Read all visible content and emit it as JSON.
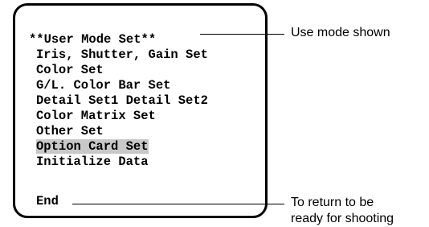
{
  "screen": {
    "title": "**User Mode Set**",
    "items": [
      {
        "label": "Iris, Shutter, Gain Set",
        "highlighted": false
      },
      {
        "label": "Color Set",
        "highlighted": false
      },
      {
        "label": "G/L. Color Bar Set",
        "highlighted": false
      },
      {
        "label": "Detail Set1 Detail Set2",
        "highlighted": false
      },
      {
        "label": "Color Matrix Set",
        "highlighted": false
      },
      {
        "label": "Other Set",
        "highlighted": false
      },
      {
        "label": "Option Card Set",
        "highlighted": true
      },
      {
        "label": "Initialize Data",
        "highlighted": false
      }
    ],
    "end_label": "End",
    "highlight_color": "#c8c8c8"
  },
  "annotations": {
    "use_mode": "Use mode shown",
    "return_line1": "To return to be",
    "return_line2": "ready for shooting"
  }
}
